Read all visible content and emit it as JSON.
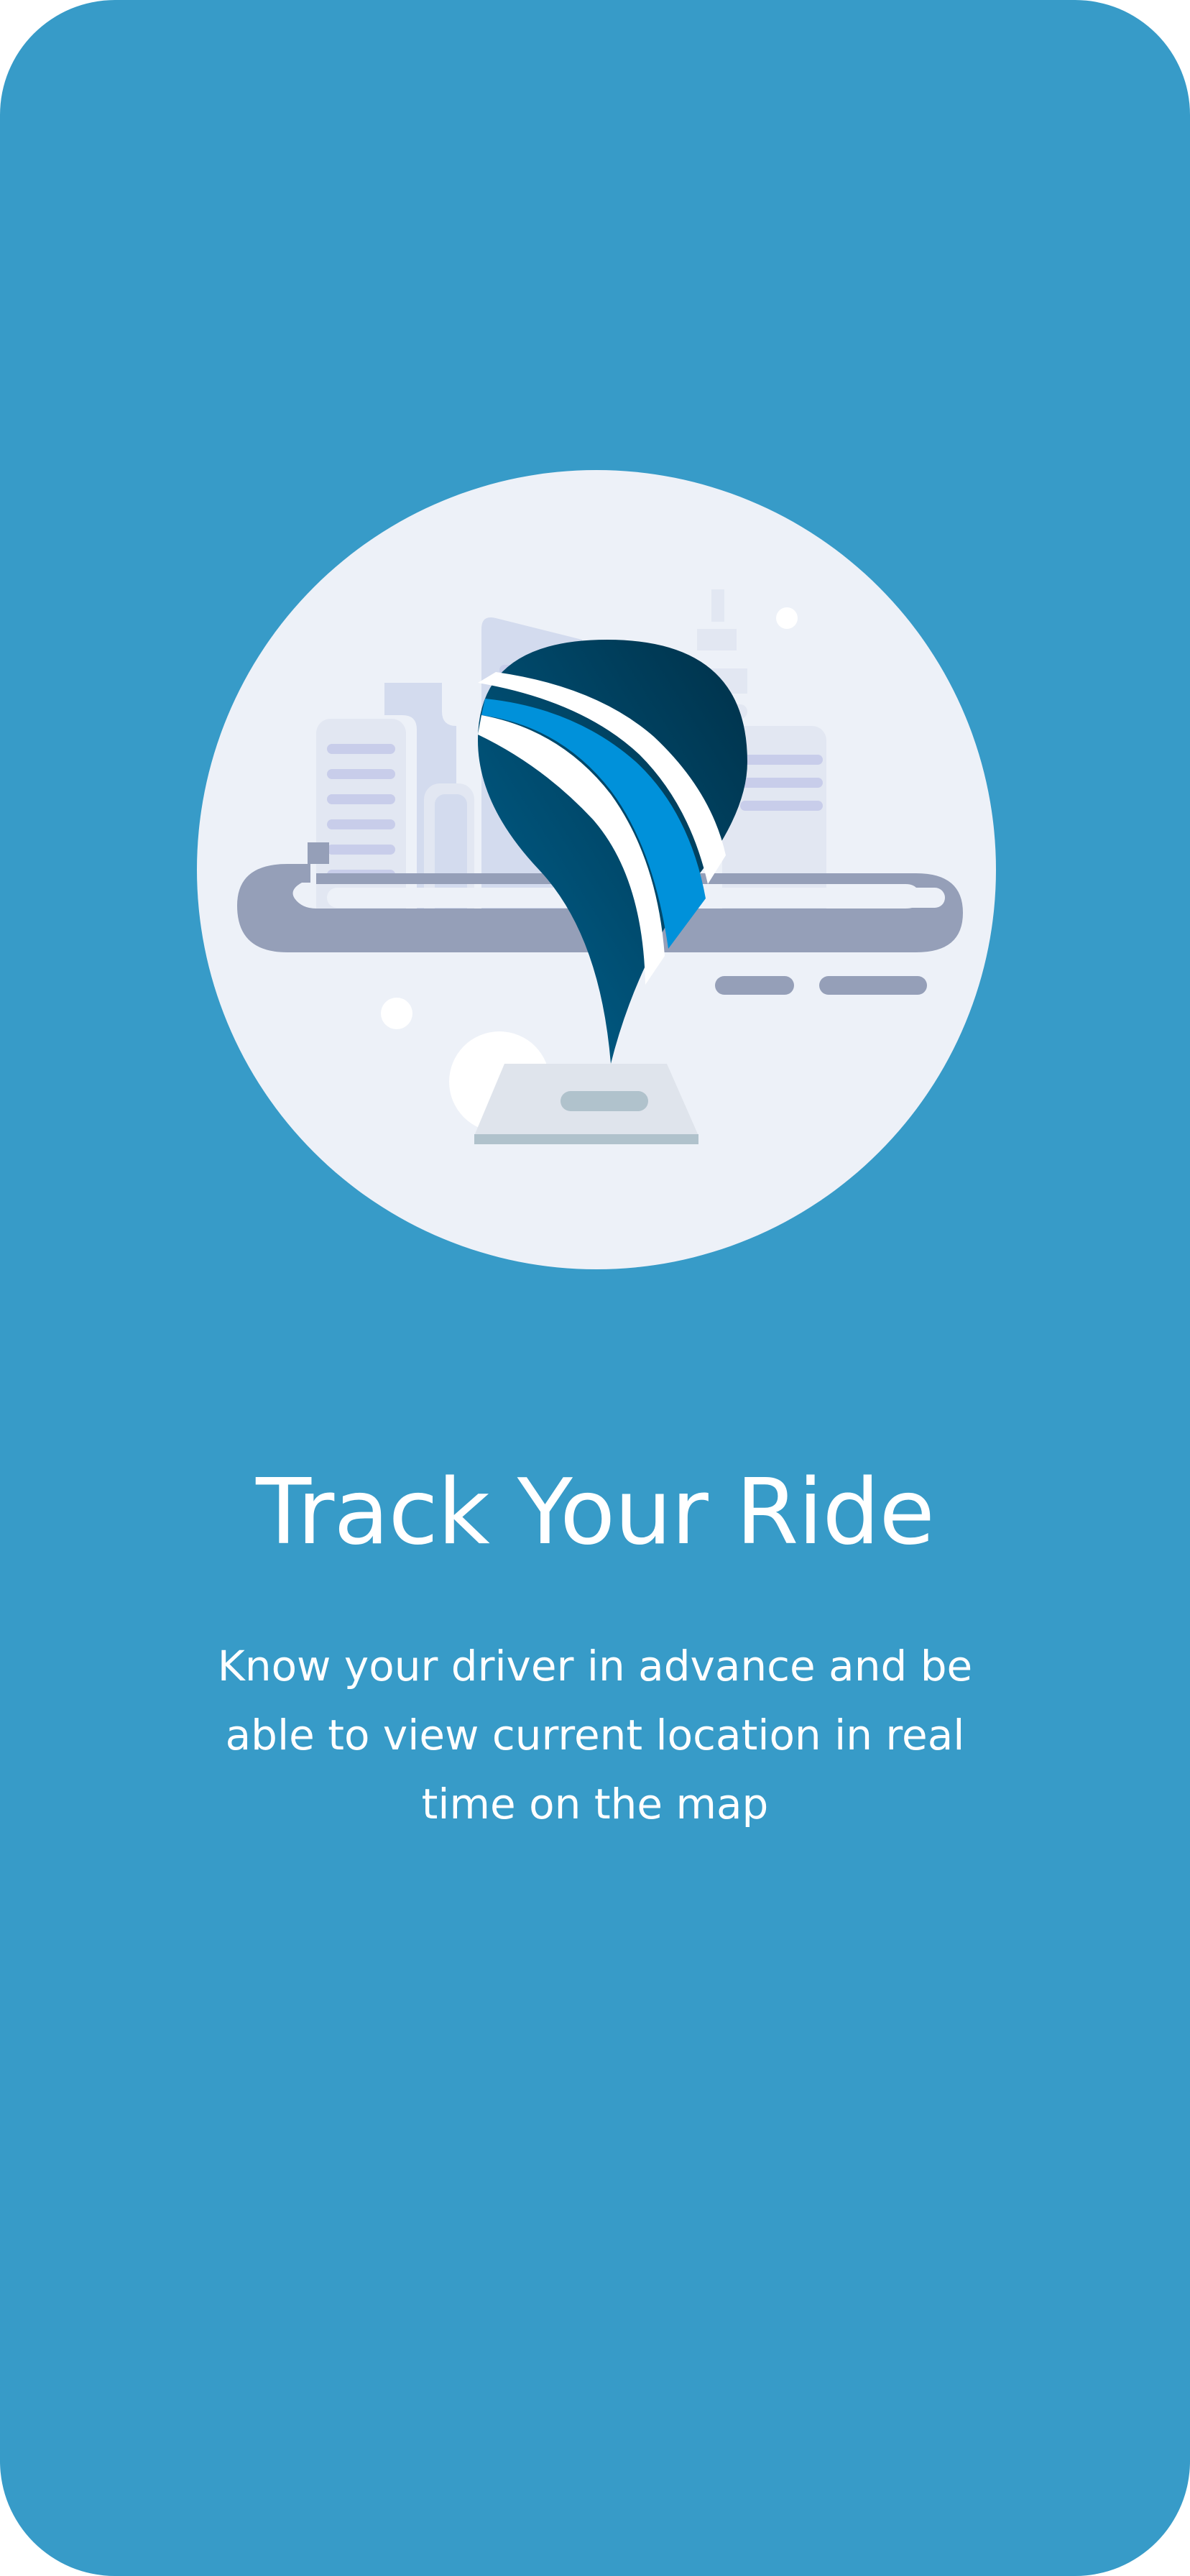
{
  "onboarding": {
    "title": "Track Your Ride",
    "description": "Know your driver in advance and be able to view current location in real time on the map",
    "illustration_icon": "map-pin-city-icon"
  },
  "colors": {
    "background": "#379bc8",
    "circle": "#edf1f8",
    "text": "#ffffff",
    "pin_dark": "#003a57",
    "pin_mid": "#005f8c",
    "pin_light": "#0091da"
  }
}
